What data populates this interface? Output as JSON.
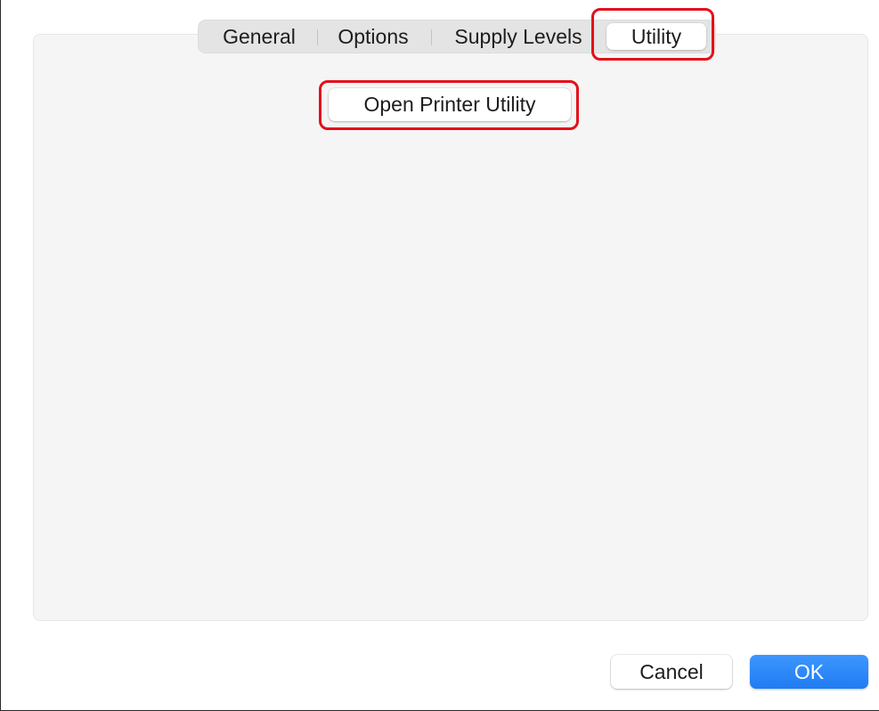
{
  "tabs": [
    {
      "label": "General",
      "selected": false
    },
    {
      "label": "Options",
      "selected": false
    },
    {
      "label": "Supply Levels",
      "selected": false
    },
    {
      "label": "Utility",
      "selected": true
    }
  ],
  "utility_panel": {
    "open_utility_label": "Open Printer Utility"
  },
  "footer": {
    "cancel_label": "Cancel",
    "ok_label": "OK"
  },
  "colors": {
    "highlight": "#e3101b",
    "accent": "#1f7cf2",
    "panel_background": "#f5f5f5"
  }
}
